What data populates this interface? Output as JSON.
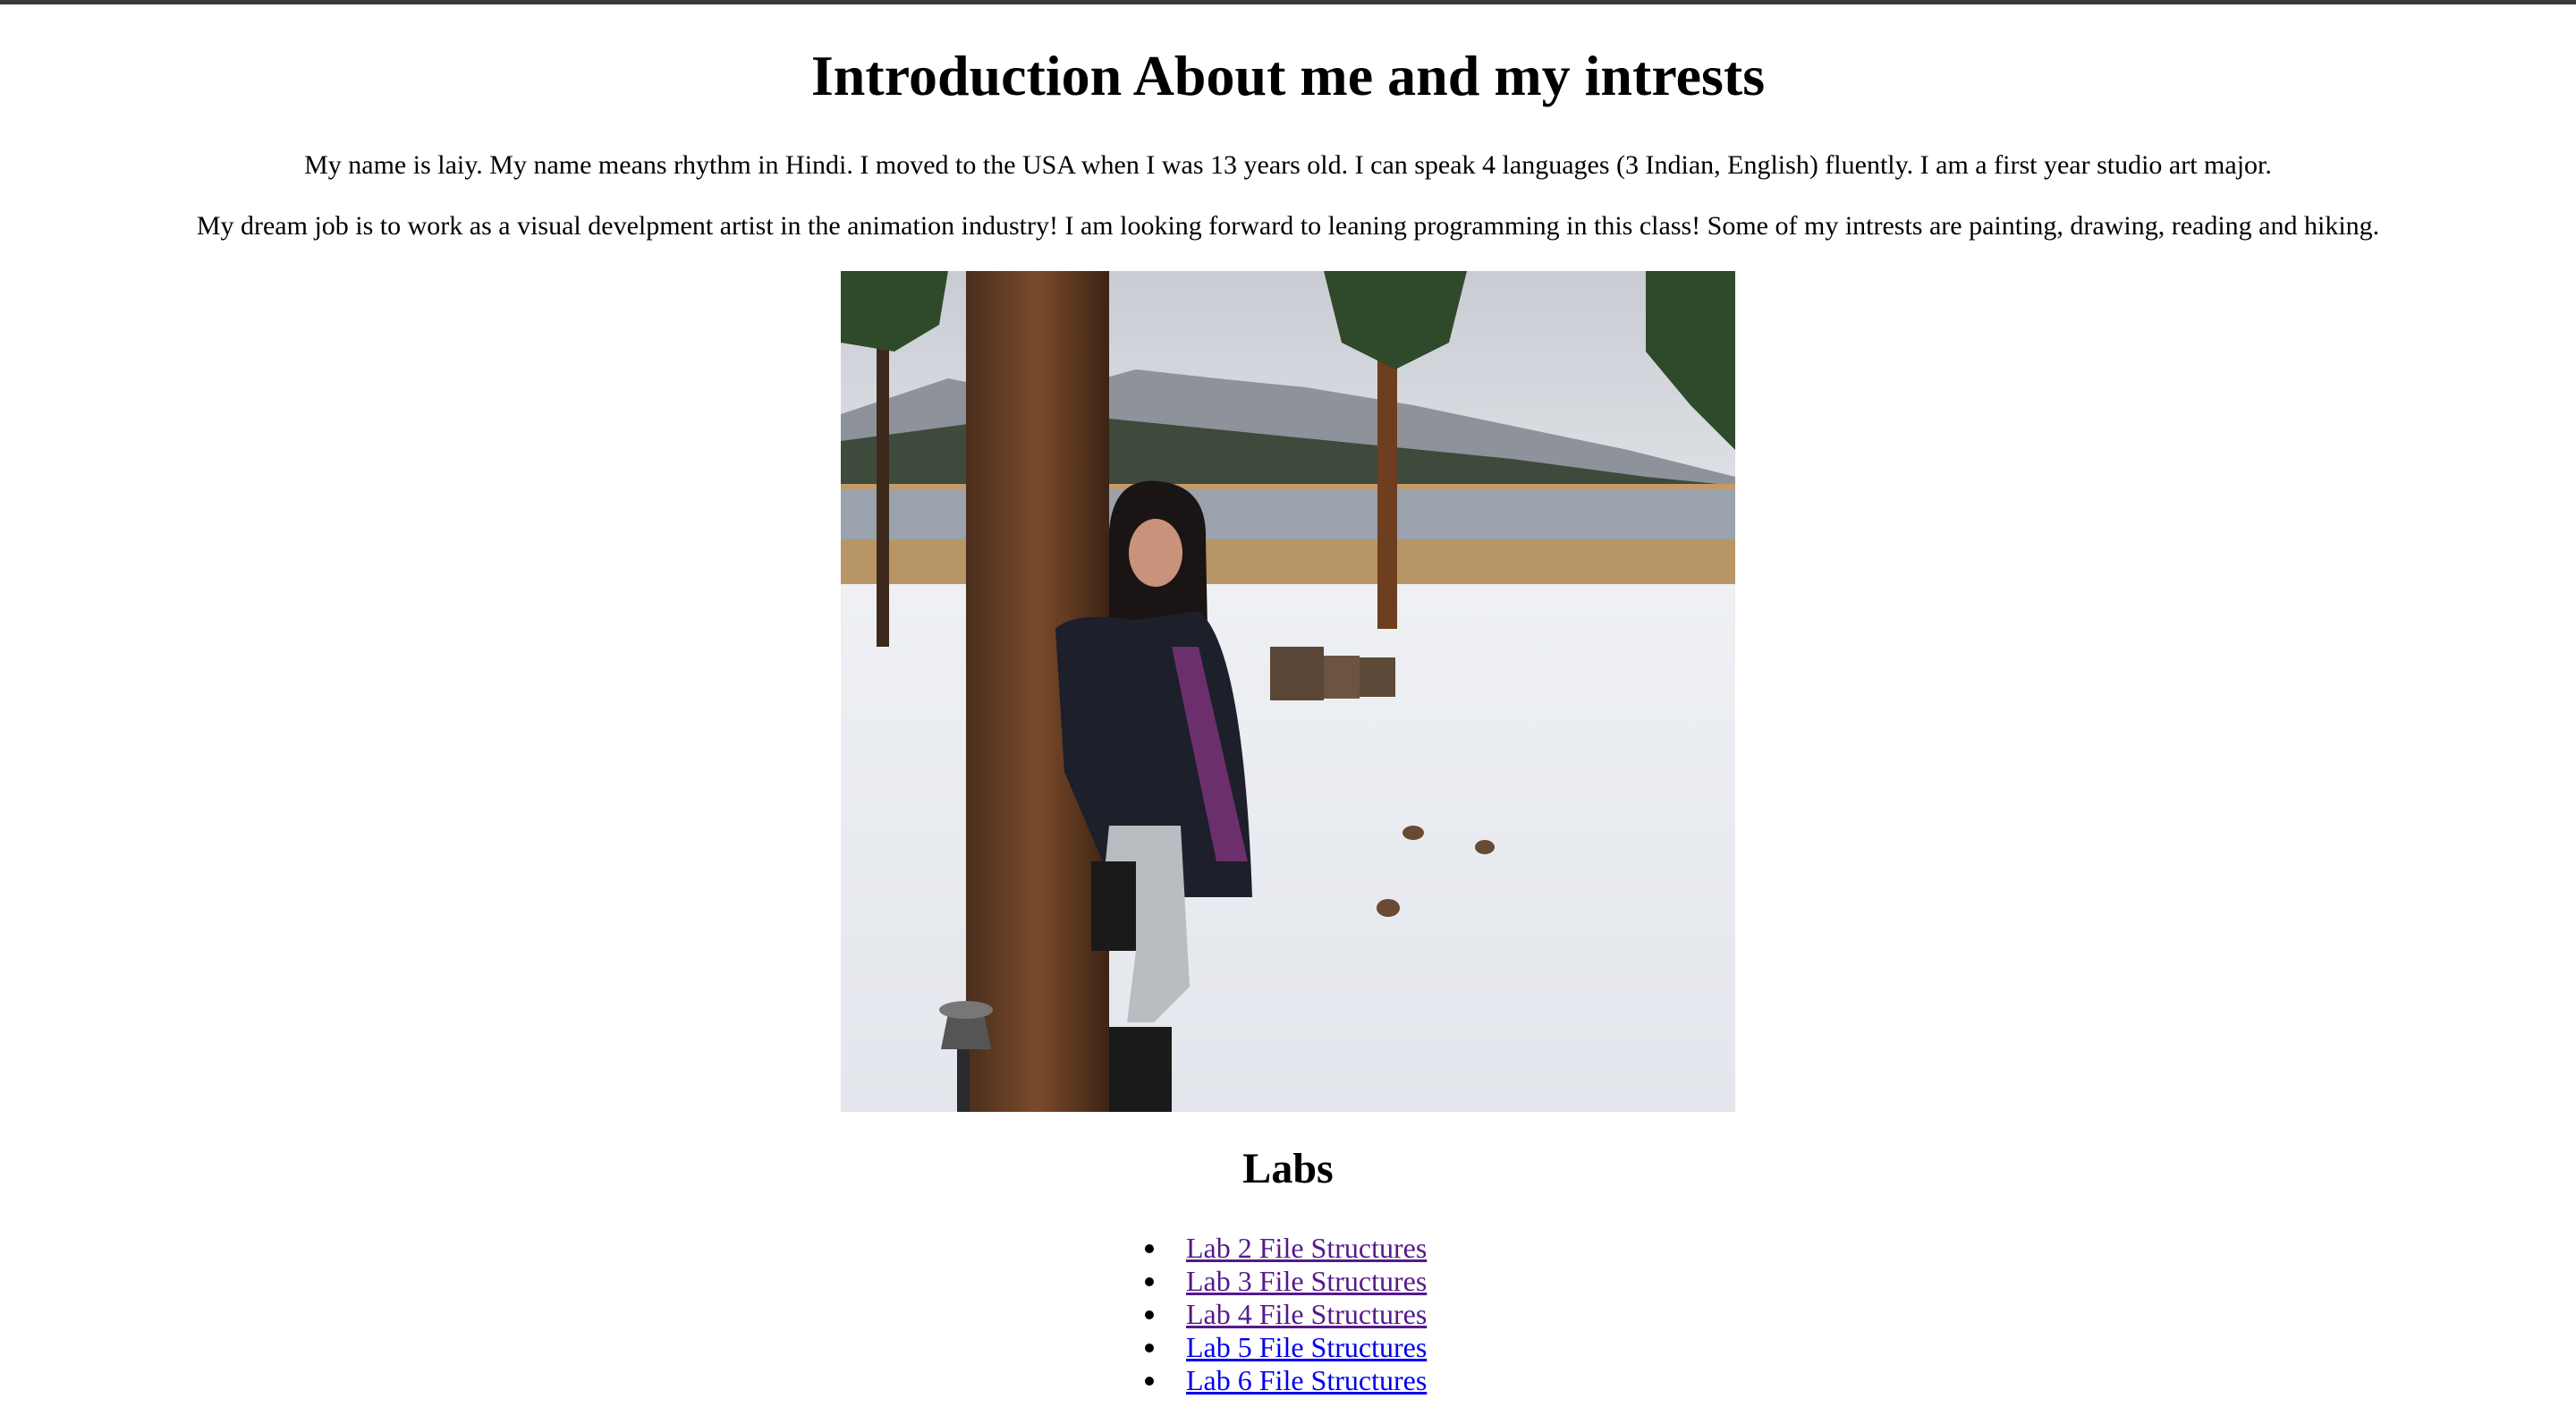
{
  "page": {
    "title": "Introduction About me and my intrests",
    "paragraphs": [
      "My name is laiy. My name means rhythm in Hindi. I moved to the USA when I was 13 years old. I can speak 4 languages (3 Indian, English) fluently. I am a first year studio art major.",
      "My dream job is to work as a visual develpment artist in the animation industry! I am looking forward to leaning programming in this class! Some of my intrests are painting, drawing, reading and hiking."
    ],
    "labs_heading": "Labs",
    "labs": [
      {
        "label": "Lab 2 File Structures",
        "visited": true
      },
      {
        "label": "Lab 3 File Structures",
        "visited": true
      },
      {
        "label": "Lab 4 File Structures",
        "visited": true
      },
      {
        "label": "Lab 5 File Structures",
        "visited": false
      },
      {
        "label": "Lab 6 File Structures",
        "visited": false
      }
    ]
  },
  "colors": {
    "link": "#0000ee",
    "link_visited": "#551a8b",
    "topbar": "#3a3a3a"
  }
}
